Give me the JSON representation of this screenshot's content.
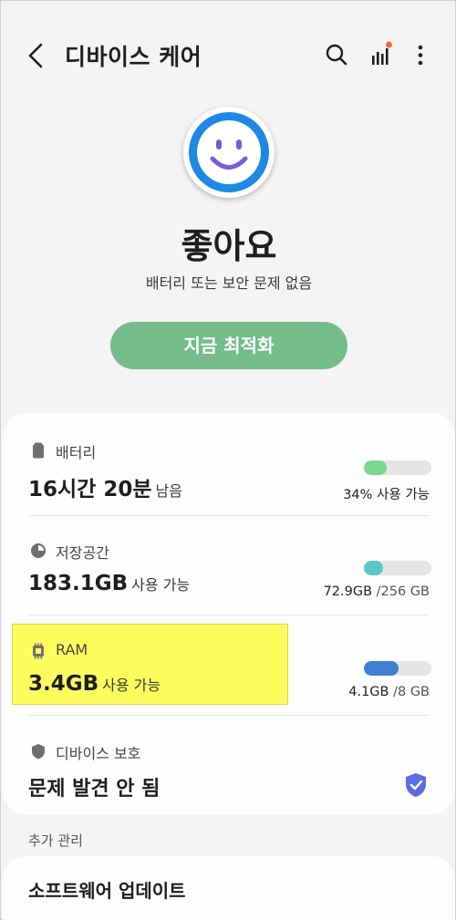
{
  "appbar": {
    "title": "디바이스 케어"
  },
  "status": {
    "title": "좋아요",
    "subtitle": "배터리 또는 보안 문제 없음",
    "optimize_label": "지금 최적화"
  },
  "items": {
    "battery": {
      "label": "배터리",
      "value": "16시간 20분",
      "unit": "남음",
      "right_main": "34% 사용 가능",
      "level": 0.34,
      "color": "#7bd88f"
    },
    "storage": {
      "label": "저장공간",
      "value": "183.1GB",
      "unit": "사용 가능",
      "right_main": "72.9GB",
      "right_sub": " /256 GB",
      "level": 0.28,
      "color": "#5cc6c8"
    },
    "ram": {
      "label": "RAM",
      "value": "3.4GB",
      "unit": "사용 가능",
      "right_main": "4.1GB",
      "right_sub": " /8 GB",
      "level": 0.51,
      "color": "#3f7fd0"
    },
    "protection": {
      "label": "디바이스 보호",
      "value": "문제 발견 안 됨"
    }
  },
  "more": {
    "section_label": "추가 관리",
    "software_update": "소프트웨어 업데이트"
  },
  "colors": {
    "accent_green": "#74bd8a",
    "face_blue": "#1e88e5",
    "smile_purple": "#7a5bd6",
    "shield": "#5a6ee0",
    "notif_dot": "#ef6c1f"
  }
}
